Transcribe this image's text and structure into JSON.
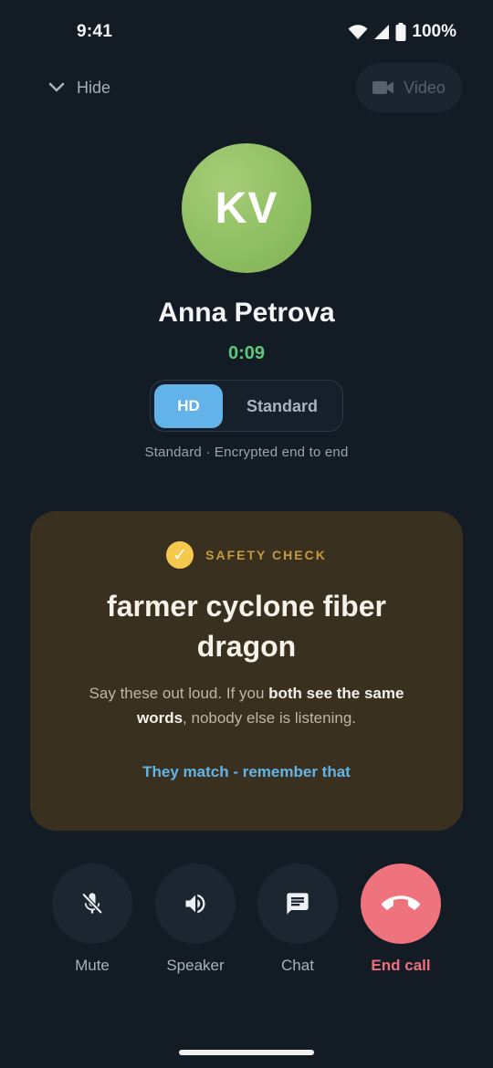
{
  "status_bar": {
    "time": "9:41",
    "battery": "100%"
  },
  "top_bar": {
    "hide_label": "Hide",
    "video_label": "Video"
  },
  "caller": {
    "initials": "KV",
    "name": "Anna Petrova",
    "timer": "0:09"
  },
  "quality": {
    "options": [
      "HD",
      "Standard"
    ],
    "selected": "HD",
    "caption": "Standard · Encrypted end to end"
  },
  "safety_check": {
    "title": "SAFETY CHECK",
    "words": "farmer cyclone fiber dragon",
    "desc_part1": "Say these out loud. If you ",
    "desc_bold1": "both see the same words",
    "desc_part2": ", nobody else is listening.",
    "confirm_label": "They match - remember that"
  },
  "controls": [
    {
      "label": "Mute",
      "icon": "mic-off-icon"
    },
    {
      "label": "Speaker",
      "icon": "speaker-icon"
    },
    {
      "label": "Chat",
      "icon": "chat-icon"
    },
    {
      "label": "End call",
      "icon": "phone-hangup-icon"
    }
  ],
  "colors": {
    "background": "#131c25",
    "accent_blue": "#62b3ea",
    "timer_green": "#5cc878",
    "safety_card": "#3a3020",
    "safety_gold": "#c39a3d",
    "end_call": "#ee737d"
  }
}
